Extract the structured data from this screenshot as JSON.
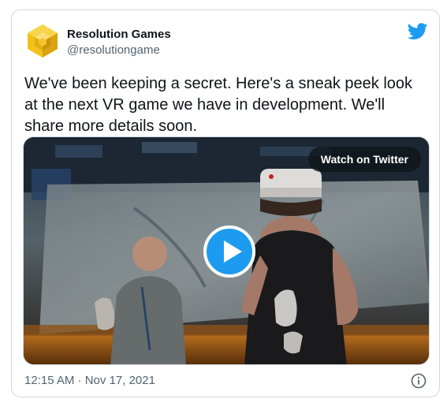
{
  "tweet": {
    "author_name": "Resolution Games",
    "author_handle": "@resolutiongame",
    "text": "We've been keeping a secret. Here's a sneak peek look at the next VR game we have in development. We'll share more details soon.",
    "timestamp": "12:15 AM · Nov 17, 2021"
  },
  "media": {
    "watch_label": "Watch on Twitter",
    "play_icon": "play-icon"
  },
  "icons": {
    "brand": "twitter-bird-icon",
    "info": "info-icon",
    "avatar": "resolution-games-logo"
  },
  "colors": {
    "accent": "#1d9bf0",
    "text": "#0f1419",
    "muted": "#536471",
    "border": "#cfd9de",
    "logo_yellow": "#f2c21b"
  }
}
